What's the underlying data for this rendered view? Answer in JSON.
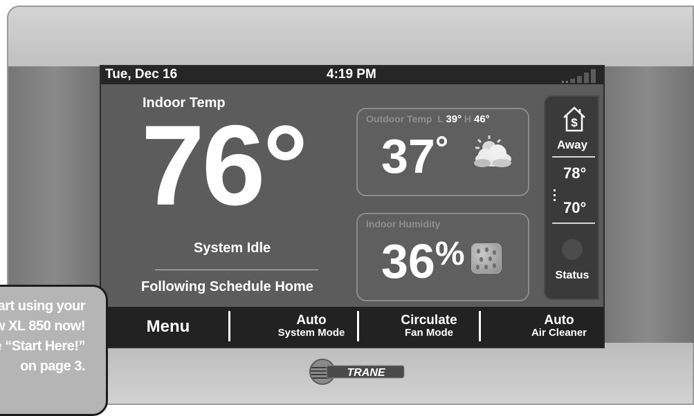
{
  "status_bar": {
    "date": "Tue, Dec 16",
    "time": "4:19 PM",
    "signal_icon": "signal-bars-icon"
  },
  "indoor": {
    "label": "Indoor Temp",
    "temperature": "76°",
    "system_status": "System Idle",
    "schedule": "Following Schedule Home"
  },
  "outdoor": {
    "label": "Outdoor Temp",
    "low_prefix": "L",
    "low": "39°",
    "high_prefix": "H",
    "high": "46°",
    "temperature": "37",
    "degree": "°",
    "icon": "partly-cloudy-icon"
  },
  "humidity": {
    "label": "Indoor Humidity",
    "value": "36",
    "unit": "%",
    "icon": "humidity-drops-icon"
  },
  "sidebar": {
    "house_icon": "house-dollar-icon",
    "mode_label": "Away",
    "cool_setpoint": "78°",
    "heat_setpoint": "70°",
    "status_label": "Status"
  },
  "bottom_bar": {
    "menu_label": "Menu",
    "system_mode_value": "Auto",
    "system_mode_label": "System Mode",
    "fan_mode_value": "Circulate",
    "fan_mode_label": "Fan Mode",
    "air_cleaner_value": "Auto",
    "air_cleaner_label": "Air Cleaner"
  },
  "brand": {
    "name": "TRANE"
  },
  "callout": {
    "line1": "art using your",
    "line2": "w XL 850 now!",
    "line3": "e “Start Here!”",
    "line4": "on page 3."
  },
  "colors": {
    "screen_bg": "#5c5c5c",
    "bar_bg": "#262626",
    "text": "#ffffff",
    "muted_text": "#8f8f8f"
  }
}
